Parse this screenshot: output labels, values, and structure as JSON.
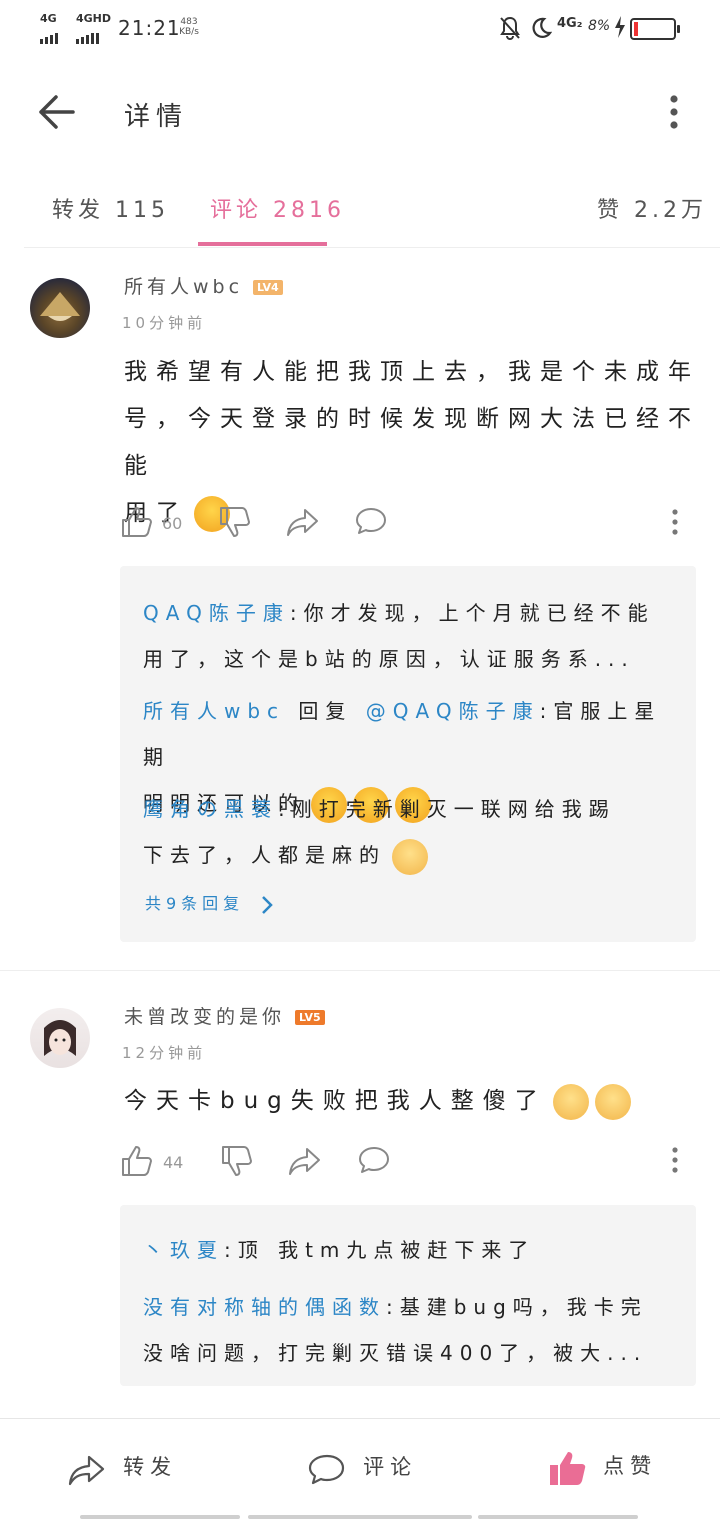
{
  "status_bar": {
    "network_left": "4G",
    "network_right": "4GHD",
    "time": "21:21",
    "speed_value": "483",
    "speed_unit": "KB/s",
    "network_status": "4G₂",
    "battery": "8%"
  },
  "header": {
    "title": "详情"
  },
  "tabs": [
    {
      "label": "转发 115"
    },
    {
      "label": "评论 2816"
    },
    {
      "label": "赞 2.2万"
    }
  ],
  "comments": [
    {
      "user": "所有人wbc",
      "level": "LV4",
      "time": "10分钟前",
      "text_line1": "我希望有人能把我顶上去，我是个未成年",
      "text_line2": "号，今天登录的时候发现断网大法已经不能",
      "text_line3": "用了",
      "likes": "60",
      "replies": [
        {
          "name": "QAQ陈子康",
          "text_line1": ":你才发现，上个月就已经不能",
          "text_line2": "用了，这个是b站的原因，认证服务系..."
        },
        {
          "name": "所有人wbc",
          "mid": " 回复 ",
          "mention": "@QAQ陈子康",
          "text_line1": ":官服上星期",
          "text_line2": "明明还可以的"
        },
        {
          "name": "鹰角の黑蓑",
          "text_line1": ":刚打完新剿灭一联网给我踢",
          "text_line2": "下去了，人都是麻的"
        }
      ],
      "reply_more": "共9条回复"
    },
    {
      "user": "未曾改变的是你",
      "level": "LV5",
      "time": "12分钟前",
      "text_line1": "今天卡bug失败把我人整傻了",
      "likes": "44",
      "replies": [
        {
          "name": "丶玖夏",
          "text_line1": ":顶 我tm九点被赶下来了"
        },
        {
          "name": "没有对称轴的偶函数",
          "text_line1": ":基建bug吗，我卡完",
          "text_line2": "没啥问题，打完剿灭错误400了，被大..."
        }
      ]
    }
  ],
  "bottom_bar": {
    "repost": "转发",
    "comment": "评论",
    "like": "点赞"
  },
  "colors": {
    "accent": "#e56f9b",
    "reply_name": "#2c86c6",
    "lv4": "#f3b46a",
    "lv5": "#ee7a2b"
  }
}
